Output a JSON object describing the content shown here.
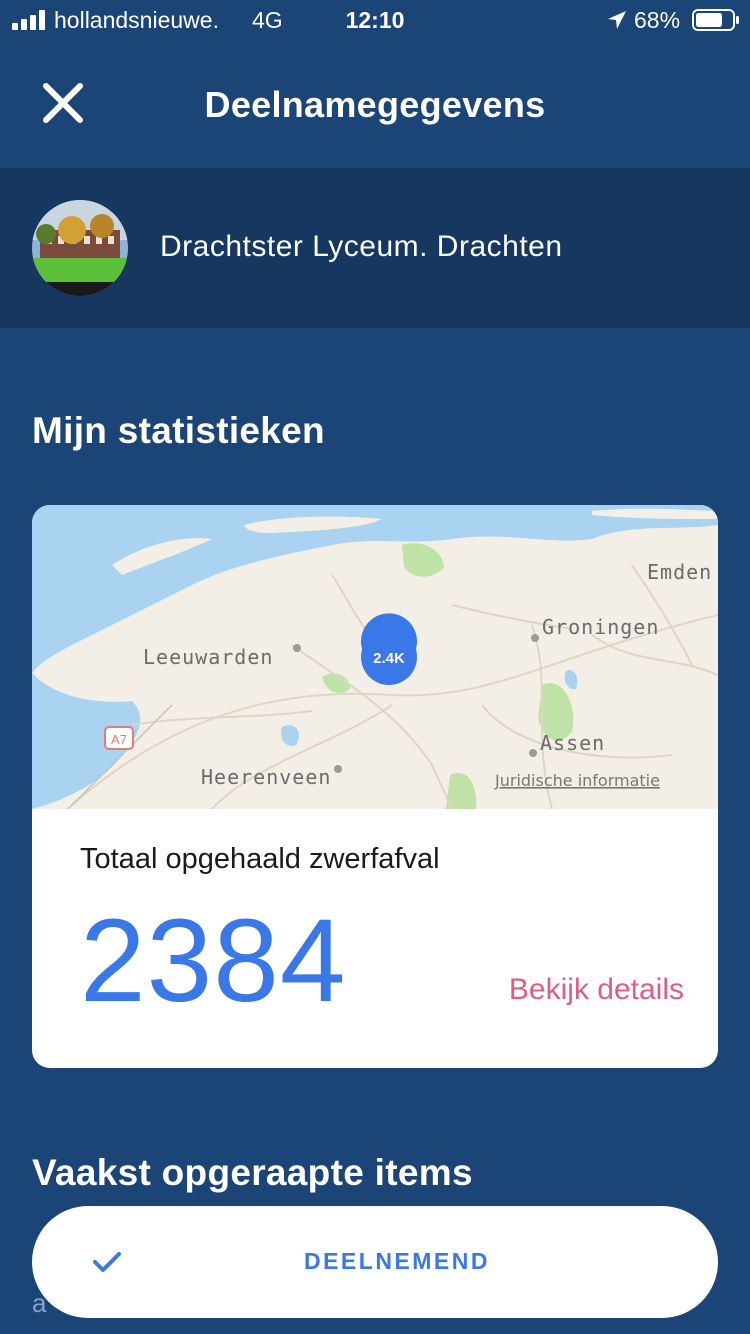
{
  "status_bar": {
    "carrier": "hollandsnieuwe.",
    "network": "4G",
    "time": "12:10",
    "battery": "68%"
  },
  "header": {
    "title": "Deelnamegegevens",
    "close_icon": "close-icon"
  },
  "school": {
    "name": "Drachtster Lyceum.  Drachten"
  },
  "stats": {
    "section_title": "Mijn statistieken",
    "map": {
      "labels": {
        "emden": "Emden",
        "groningen": "Groningen",
        "leeuwarden": "Leeuwarden",
        "assen": "Assen",
        "heerenveen": "Heerenveen",
        "road": "A7"
      },
      "pin_label": "2.4K",
      "legal": "Juridische informatie"
    },
    "label": "Totaal opgehaald zwerfafval",
    "value": "2384",
    "details_link": "Bekijk details"
  },
  "items": {
    "section_title": "Vaakst opgeraapte items",
    "peek": "a"
  },
  "participate_button": {
    "label": "DEELNEMEND",
    "icon": "check-icon"
  },
  "colors": {
    "background": "#1b4477",
    "school_bar": "#16375f",
    "accent_blue": "#3b78e7",
    "link_pink": "#e05d86"
  }
}
